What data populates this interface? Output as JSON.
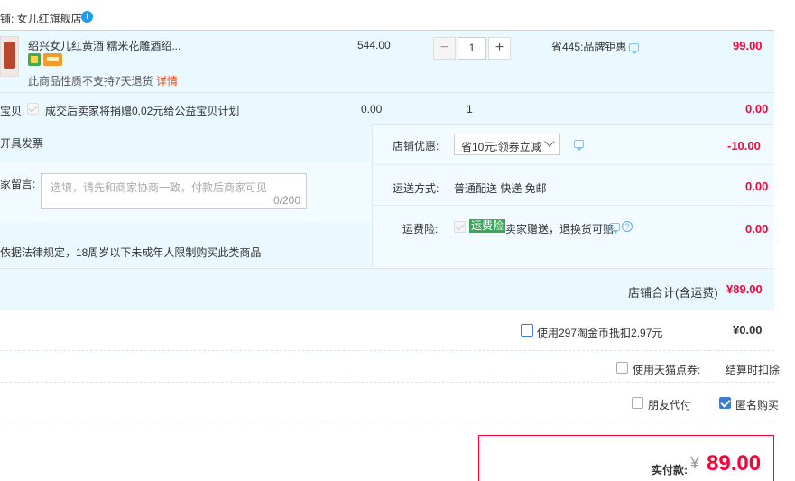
{
  "shop": {
    "label": "铺: 女儿红旗舰店",
    "badge_text": "i"
  },
  "item": {
    "title": "绍兴女儿红黄酒 糯米花雕酒绍...",
    "price": "544.00",
    "qty": "1",
    "minus": "−",
    "plus": "+",
    "discount": "省445:品牌钜惠",
    "subtotal": "99.00",
    "notice": "此商品性质不支持7天退货",
    "detail_link": "详情"
  },
  "charity": {
    "label_prefix": "宝贝",
    "text": "成交后卖家将捐赠0.02元给公益宝贝计划",
    "price": "0.00",
    "qty": "1",
    "subtotal": "0.00"
  },
  "invoice": {
    "label": "开具发票"
  },
  "message": {
    "label": "家留言:",
    "placeholder": "选填，请先和商家协商一致，付款后商家可见",
    "count": "0/200"
  },
  "legal_notice": "依据法律规定，18周岁以下未成年人限制购买此类商品",
  "coupon": {
    "label": "店铺优惠:",
    "selected": "省10元:领券立减",
    "amount": "-10.00"
  },
  "shipping": {
    "label": "运送方式:",
    "value": "普通配送 快递 免邮",
    "amount": "0.00"
  },
  "insurance": {
    "label": "运费险:",
    "badge": "运费险",
    "text": "卖家赠送，退换货可赔",
    "help": "?",
    "amount": "0.00"
  },
  "shop_total": {
    "label": "店铺合计(含运费)",
    "amount": "¥89.00"
  },
  "taobao_coins": {
    "label": "使用297淘金币抵扣2.97元",
    "amount": "¥0.00"
  },
  "tmall_points": {
    "label": "使用天猫点券:",
    "value": "结算时扣除"
  },
  "friend_pay": {
    "label": "朋友代付"
  },
  "anonymous": {
    "label": "匿名购买"
  },
  "payment": {
    "label": "实付款:",
    "currency": "¥",
    "amount": "89.00"
  },
  "colors": {
    "accent_red": "#ff0036",
    "band_blue": "#eaf8ff",
    "border_blue": "#b6d9ef",
    "check_blue": "#3d7bd6",
    "badge_green": "#3ba55b"
  }
}
